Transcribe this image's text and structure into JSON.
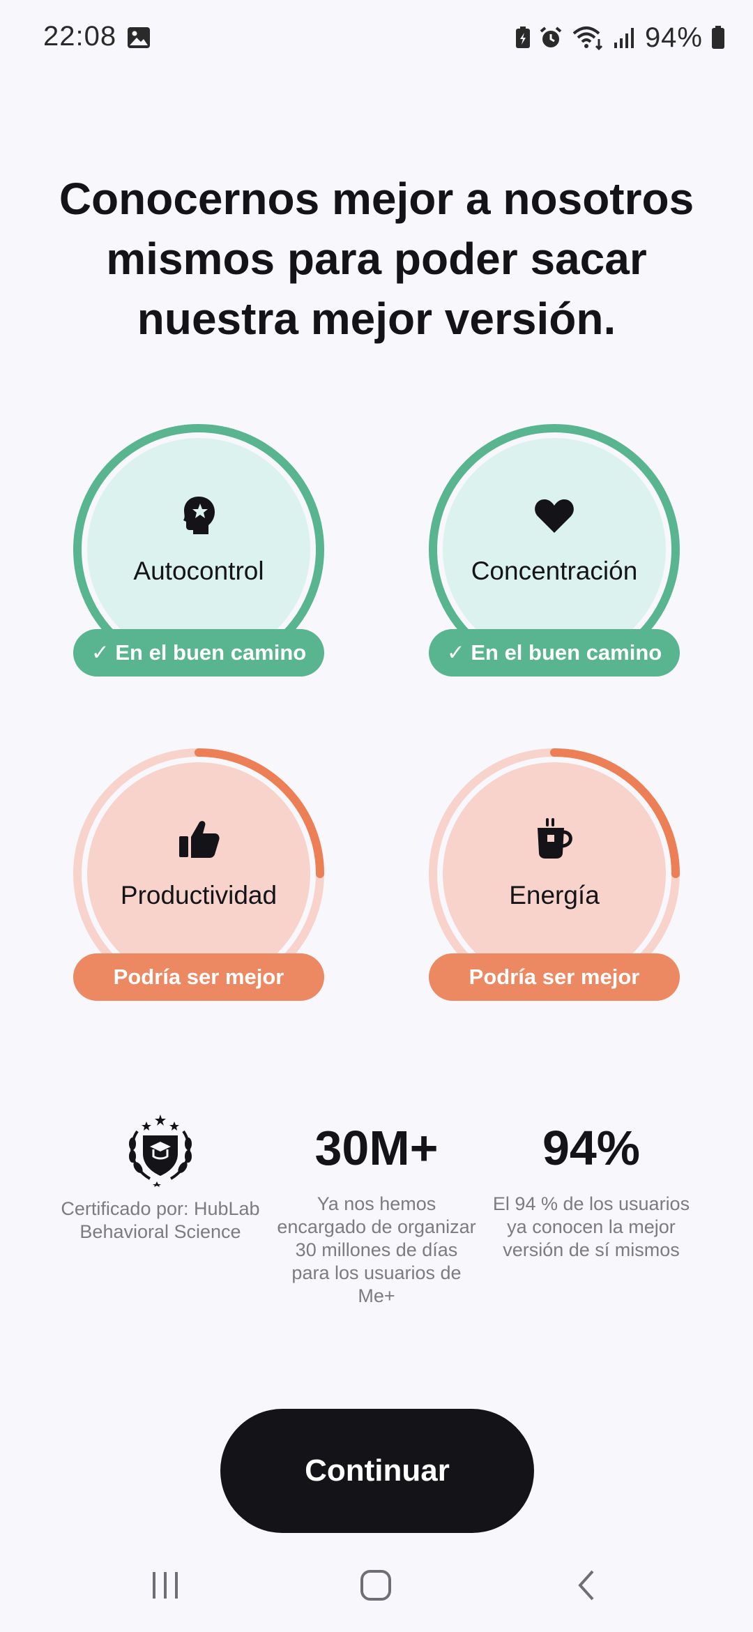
{
  "status_bar": {
    "time": "22:08",
    "battery_text": "94%",
    "icons": [
      "gallery-icon",
      "battery-saver-icon",
      "alarm-icon",
      "wifi-icon",
      "signal-icon",
      "battery-icon"
    ]
  },
  "headline": "Conocernos mejor a nosotros mismos para poder sacar nuestra mejor versión.",
  "cards": [
    {
      "label": "Autocontrol",
      "badge": "✓ En el buen camino",
      "icon": "head-star-icon",
      "state": "good",
      "progress": 1.0
    },
    {
      "label": "Concentración",
      "badge": "✓ En el buen camino",
      "icon": "heart-icon",
      "state": "good",
      "progress": 1.0
    },
    {
      "label": "Productividad",
      "badge": "Podría ser mejor",
      "icon": "thumbs-up-icon",
      "state": "warn",
      "progress": 0.25
    },
    {
      "label": "Energía",
      "badge": "Podría ser mejor",
      "icon": "coffee-cup-icon",
      "state": "warn",
      "progress": 0.25
    }
  ],
  "stats": {
    "certified": {
      "text": "Certificado por: HubLab Behavioral Science",
      "icon": "laurel-crest-icon"
    },
    "days": {
      "value": "30M+",
      "text": "Ya nos hemos encargado de organizar 30 millones de días para los usuarios de Me+"
    },
    "users": {
      "value": "94%",
      "text": "El 94 % de los usuarios ya conocen la mejor versión de sí mismos"
    }
  },
  "continue_label": "Continuar",
  "colors": {
    "good_ring": "#58B590",
    "good_fill": "#DCF2EE",
    "warn_ring": "#EC7F56",
    "warn_track": "#F7D3CC",
    "warn_badge": "#EC8962",
    "button": "#141317"
  },
  "nav": [
    "recents-icon",
    "home-icon",
    "back-icon"
  ]
}
